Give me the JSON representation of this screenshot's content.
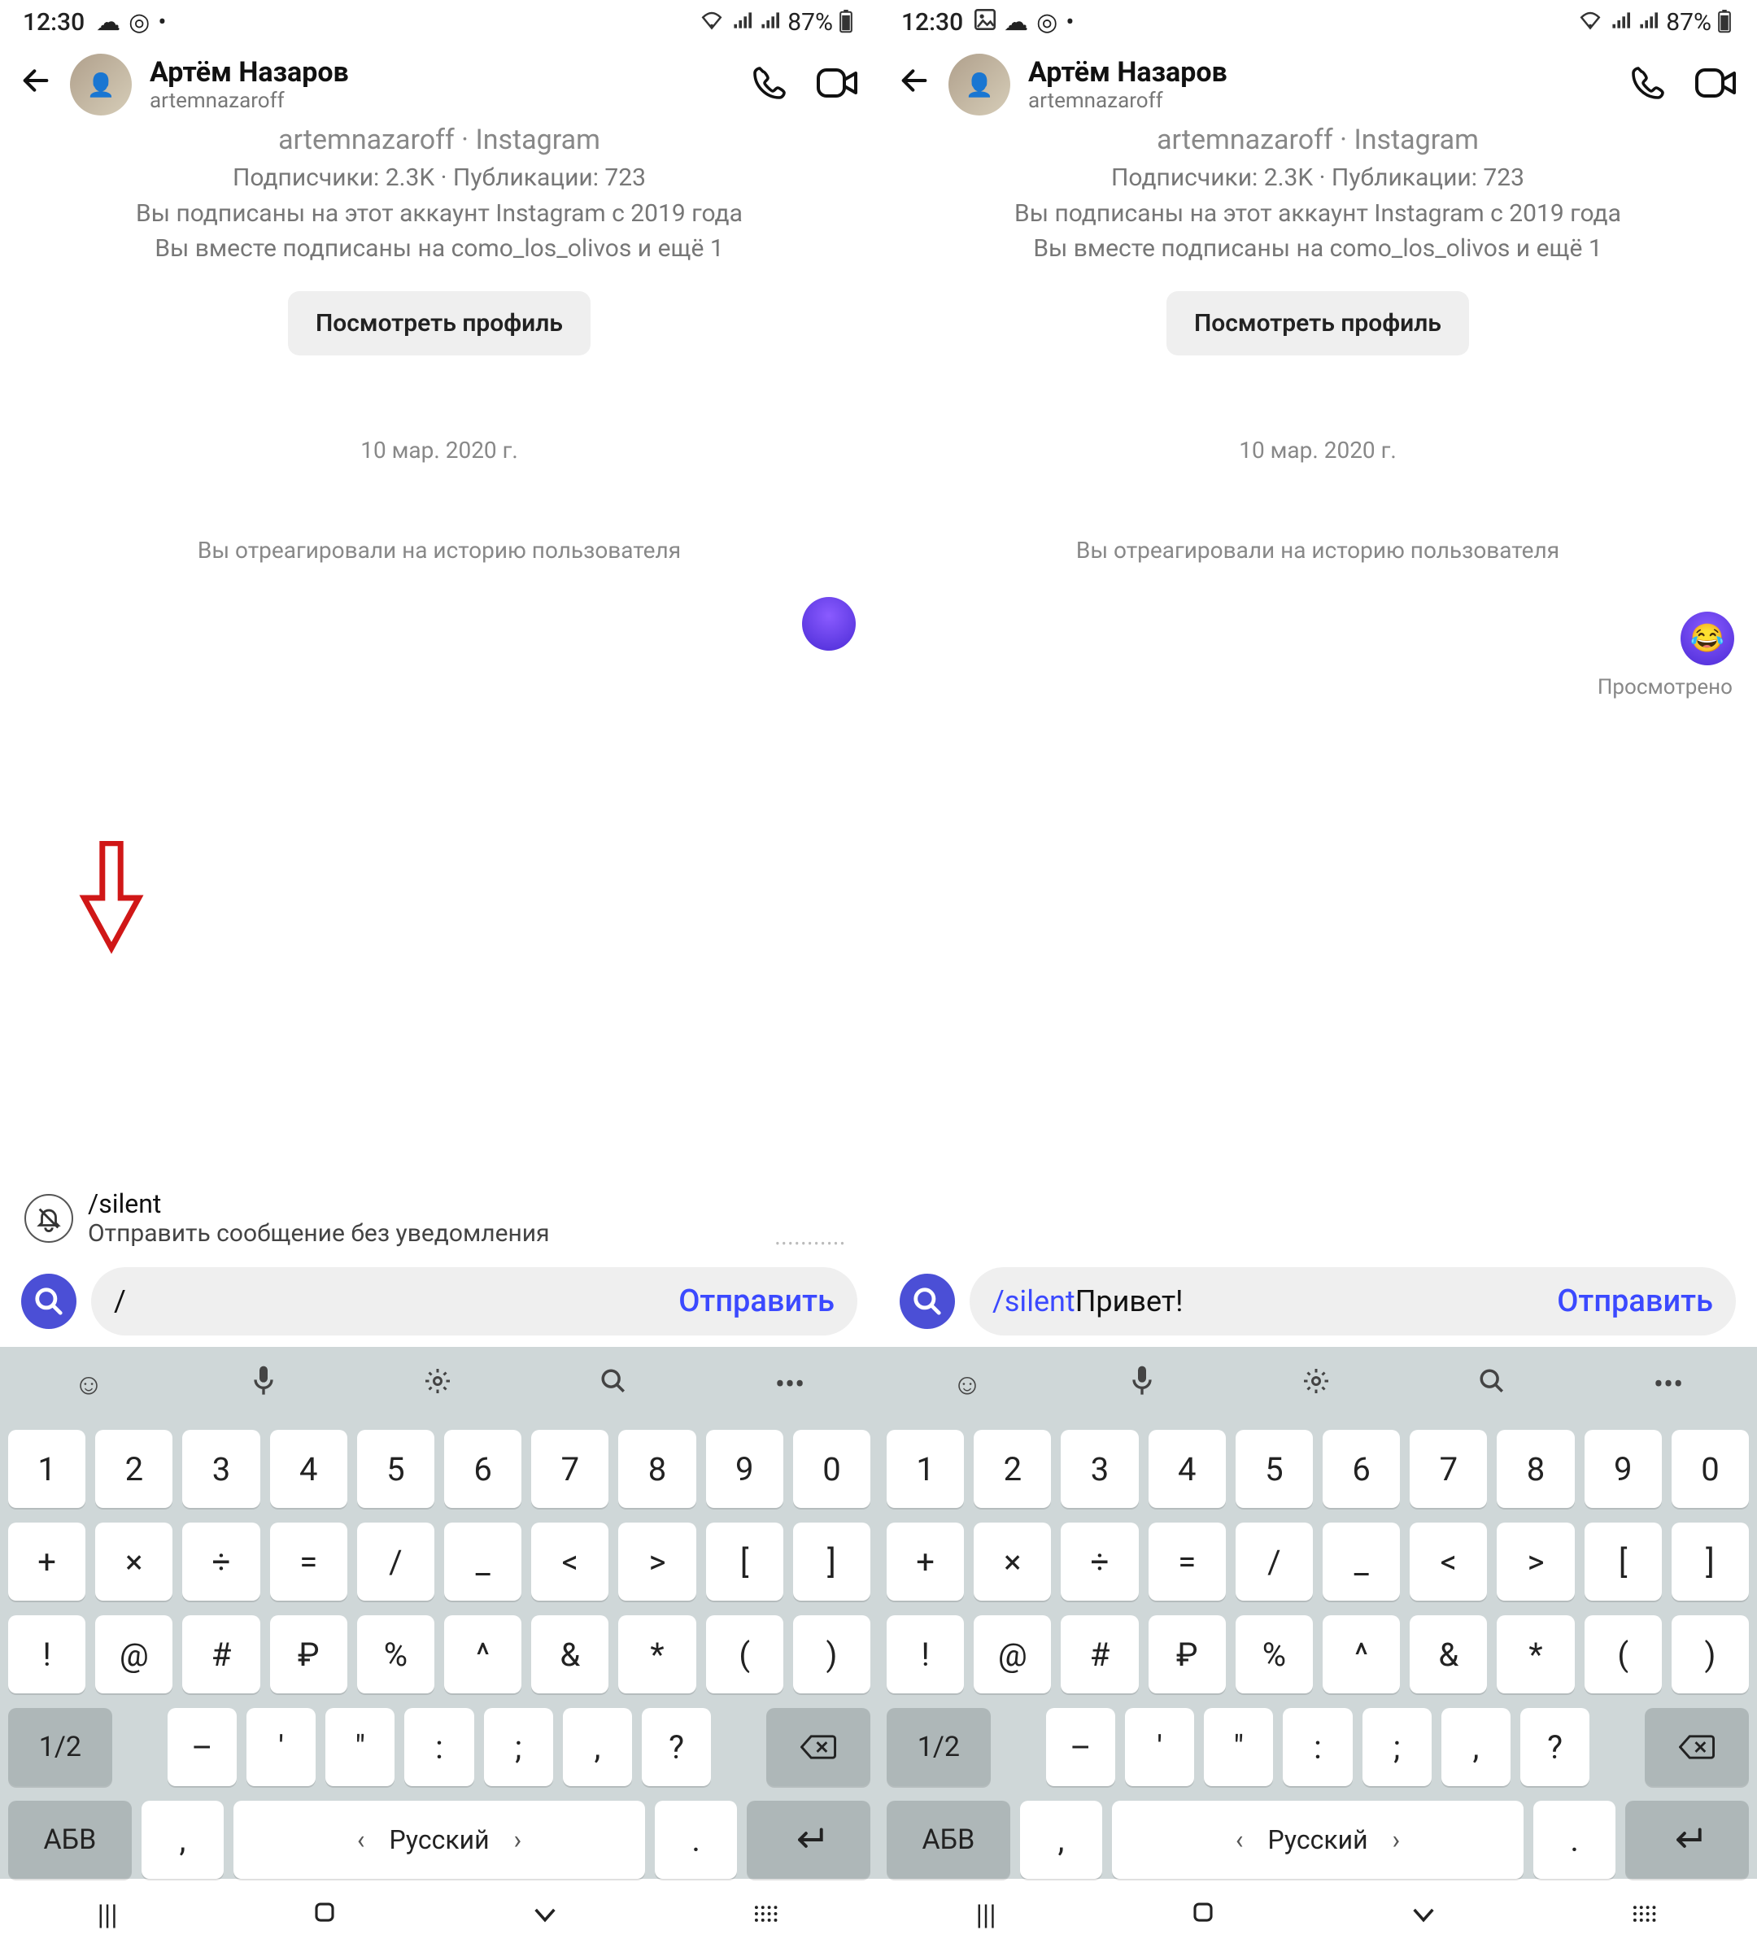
{
  "status": {
    "time": "12:30",
    "battery": "87%"
  },
  "chat": {
    "display_name": "Артём Назаров",
    "username": "artemnazaroff",
    "profile_line": "artemnazaroff · Instagram",
    "stats": "Подписчики: 2.3K · Публикации: 723",
    "follow_since": "Вы подписаны на этот аккаунт Instagram с 2019 года",
    "mutual": "Вы вместе подписаны на como_los_olivos и ещё 1",
    "view_profile": "Посмотреть профиль",
    "date": "10 мар. 2020 г.",
    "reaction_text": "Вы отреагировали на историю пользователя",
    "seen": "Просмотрено",
    "seen_faded": "Просмотрено"
  },
  "suggestion": {
    "command": "/silent",
    "description": "Отправить сообщение без уведомления"
  },
  "composer": {
    "left_value": "/",
    "right_cmd": "/silent",
    "right_value": " Привет!",
    "send": "Отправить"
  },
  "keyboard": {
    "row1": [
      "1",
      "2",
      "3",
      "4",
      "5",
      "6",
      "7",
      "8",
      "9",
      "0"
    ],
    "row2": [
      "+",
      "×",
      "÷",
      "=",
      "/",
      "_",
      "<",
      ">",
      "[",
      "]"
    ],
    "row3": [
      "!",
      "@",
      "#",
      "₽",
      "%",
      "^",
      "&",
      "*",
      "(",
      ")"
    ],
    "row4_switch": "1/2",
    "row4": [
      "–",
      "'",
      "\"",
      ":",
      ";",
      ",",
      "?"
    ],
    "abc": "АБВ",
    "space": "Русский",
    "comma": ",",
    "dot": "."
  },
  "emoji": "😂"
}
